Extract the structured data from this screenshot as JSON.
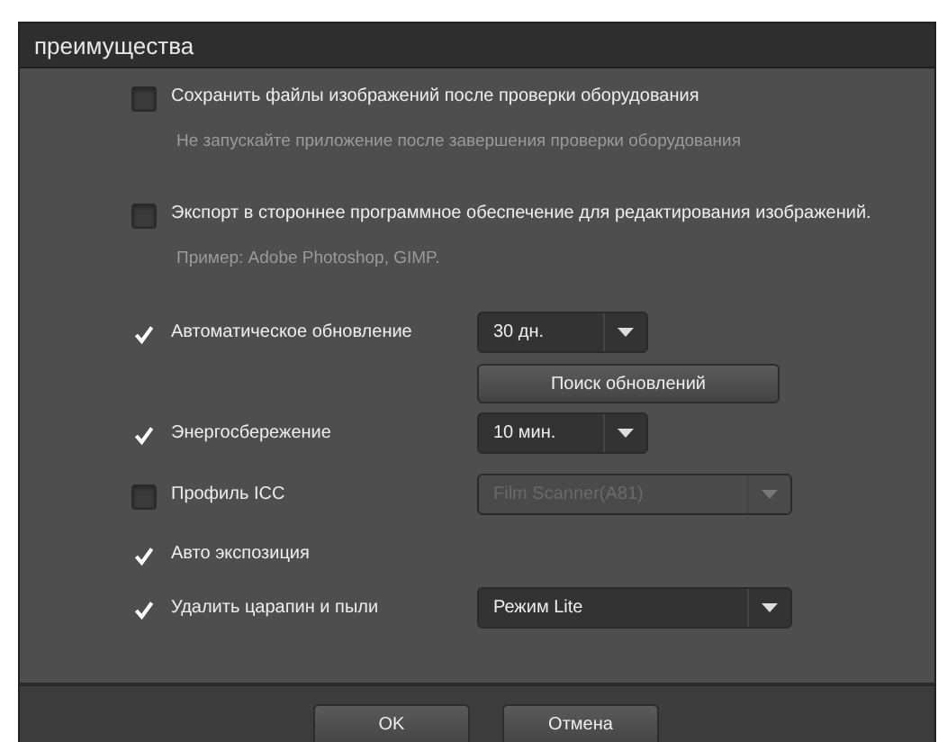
{
  "window": {
    "title": "преимущества"
  },
  "options": [
    {
      "label": "Сохранить файлы изображений после проверки оборудования",
      "checked": false,
      "note": "Не запускайте приложение после завершения проверки оборудования"
    },
    {
      "label": "Экспорт в стороннее программное обеспечение для редактирования изображений.",
      "checked": false,
      "note": "Пример: Adobe Photoshop, GIMP."
    },
    {
      "label": "Автоматическое обновление",
      "checked": true,
      "select": {
        "value": "30 дн.",
        "kind": "short",
        "disabled": false
      },
      "button": "Поиск обновлений"
    },
    {
      "label": "Энергосбережение",
      "checked": true,
      "select": {
        "value": "10 мин.",
        "kind": "short",
        "disabled": false
      }
    },
    {
      "label": "Профиль ICC",
      "checked": false,
      "select": {
        "value": "Film Scanner(A81)",
        "kind": "wide",
        "disabled": true
      }
    },
    {
      "label": "Авто экспозиция",
      "checked": true
    },
    {
      "label": "Удалить царапин и пыли",
      "checked": true,
      "select": {
        "value": "Режим Lite",
        "kind": "wide",
        "disabled": false
      }
    }
  ],
  "buttons": [
    "OK",
    "Отмена"
  ]
}
